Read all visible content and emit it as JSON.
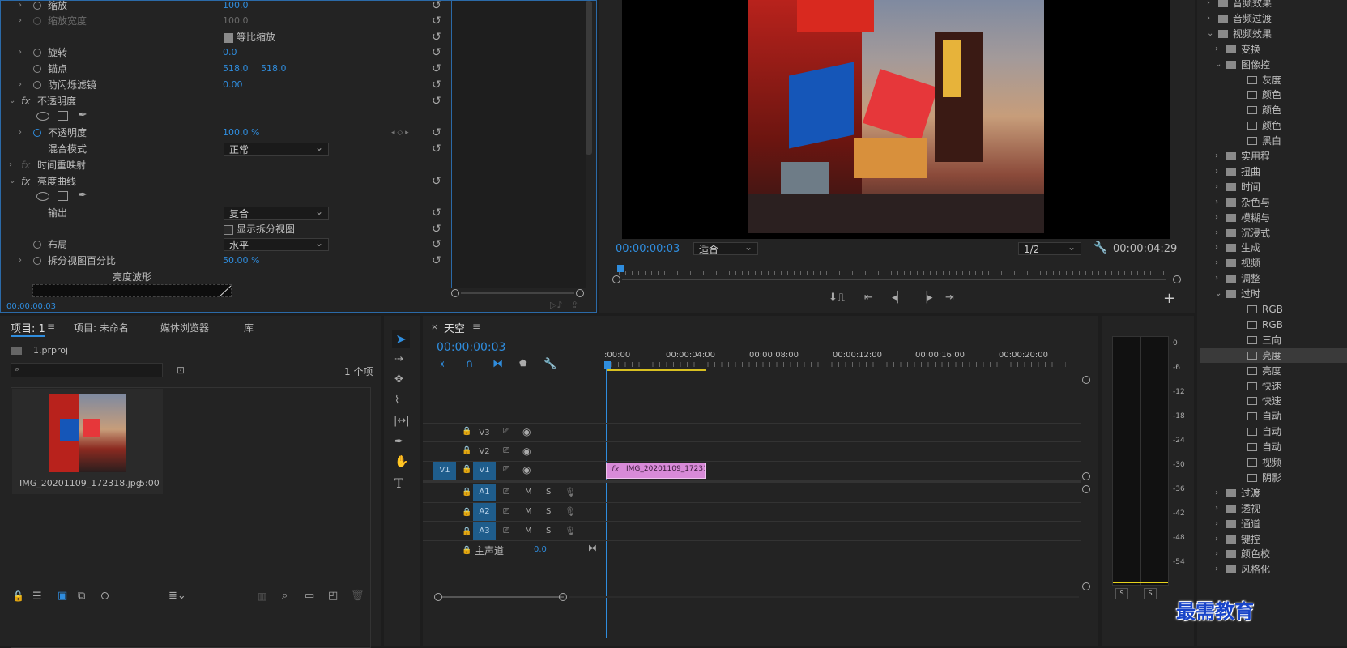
{
  "effect_controls": {
    "rows": [
      {
        "label": "缩放",
        "value": "100.0"
      },
      {
        "label": "缩放宽度",
        "value": "100.0"
      },
      {
        "checkbox_label": "等比缩放"
      },
      {
        "label": "旋转",
        "value": "0.0"
      },
      {
        "label": "锚点",
        "value1": "518.0",
        "value2": "518.0"
      },
      {
        "label": "防闪烁滤镜",
        "value": "0.00"
      },
      {
        "label": "不透明度",
        "fx": "fx"
      },
      {
        "label": "不透明度",
        "value": "100.0 %"
      },
      {
        "label": "混合模式",
        "select": "正常"
      },
      {
        "label": "时间重映射",
        "fx": "fx"
      },
      {
        "label": "亮度曲线",
        "fx": "fx"
      },
      {
        "label": "输出",
        "select": "复合"
      },
      {
        "checkbox_label": "显示拆分视图"
      },
      {
        "label": "布局",
        "select": "水平"
      },
      {
        "label": "拆分视图百分比",
        "value": "50.00 %"
      },
      {
        "label": "亮度波形"
      }
    ],
    "timecode": "00:00:00:03"
  },
  "program_monitor": {
    "current_time": "00:00:00:03",
    "zoom": "适合",
    "resolution": "1/2",
    "duration": "00:00:04:29"
  },
  "project": {
    "tabs": [
      "项目: 1",
      "项目: 未命名",
      "媒体浏览器",
      "库"
    ],
    "file": "1.prproj",
    "item_count": "1 个项",
    "clip_name": "IMG_20201109_172318.jpg",
    "clip_duration": "5:00"
  },
  "timeline": {
    "title": "天空",
    "timecode": "00:00:00:03",
    "ruler": [
      ":00:00",
      "00:00:04:00",
      "00:00:08:00",
      "00:00:12:00",
      "00:00:16:00",
      "00:00:20:00"
    ],
    "video_tracks": [
      "V3",
      "V2",
      "V1"
    ],
    "source_patch": "V1",
    "audio_tracks": [
      "A1",
      "A2",
      "A3"
    ],
    "master_label": "主声道",
    "master_value": "0.0",
    "clip_label": "IMG_20201109_172318.",
    "m": "M",
    "s": "S"
  },
  "meter": {
    "scale": [
      "0",
      "-6",
      "-12",
      "-18",
      "-24",
      "-30",
      "-36",
      "-42",
      "-48",
      "-54"
    ],
    "solo": "S"
  },
  "effects_panel": {
    "items": [
      {
        "t": "folder",
        "label": "音频效果",
        "d": 0
      },
      {
        "t": "folder",
        "label": "音频过渡",
        "d": 0
      },
      {
        "t": "folder",
        "label": "视频效果",
        "d": 0,
        "open": true
      },
      {
        "t": "folder",
        "label": "变换",
        "d": 1
      },
      {
        "t": "folder",
        "label": "图像控",
        "d": 1,
        "open": true
      },
      {
        "t": "fx",
        "label": "灰度",
        "d": 2
      },
      {
        "t": "fx",
        "label": "颜色",
        "d": 2
      },
      {
        "t": "fx",
        "label": "颜色",
        "d": 2
      },
      {
        "t": "fx",
        "label": "颜色",
        "d": 2
      },
      {
        "t": "fx",
        "label": "黑白",
        "d": 2
      },
      {
        "t": "folder",
        "label": "实用程",
        "d": 1
      },
      {
        "t": "folder",
        "label": "扭曲",
        "d": 1
      },
      {
        "t": "folder",
        "label": "时间",
        "d": 1
      },
      {
        "t": "folder",
        "label": "杂色与",
        "d": 1
      },
      {
        "t": "folder",
        "label": "模糊与",
        "d": 1
      },
      {
        "t": "folder",
        "label": "沉浸式",
        "d": 1
      },
      {
        "t": "folder",
        "label": "生成",
        "d": 1
      },
      {
        "t": "folder",
        "label": "视频",
        "d": 1
      },
      {
        "t": "folder",
        "label": "调整",
        "d": 1
      },
      {
        "t": "folder",
        "label": "过时",
        "d": 1,
        "open": true
      },
      {
        "t": "fx",
        "label": "RGB",
        "d": 2
      },
      {
        "t": "fx",
        "label": "RGB",
        "d": 2
      },
      {
        "t": "fx",
        "label": "三向",
        "d": 2
      },
      {
        "t": "fx",
        "label": "亮度",
        "d": 2,
        "selected": true
      },
      {
        "t": "fx",
        "label": "亮度",
        "d": 2
      },
      {
        "t": "fx",
        "label": "快速",
        "d": 2
      },
      {
        "t": "fx",
        "label": "快速",
        "d": 2
      },
      {
        "t": "fx",
        "label": "自动",
        "d": 2
      },
      {
        "t": "fx",
        "label": "自动",
        "d": 2
      },
      {
        "t": "fx",
        "label": "自动",
        "d": 2
      },
      {
        "t": "fx",
        "label": "视频",
        "d": 2
      },
      {
        "t": "fx",
        "label": "阴影",
        "d": 2
      },
      {
        "t": "folder",
        "label": "过渡",
        "d": 1
      },
      {
        "t": "folder",
        "label": "透视",
        "d": 1
      },
      {
        "t": "folder",
        "label": "通道",
        "d": 1
      },
      {
        "t": "folder",
        "label": "键控",
        "d": 1
      },
      {
        "t": "folder",
        "label": "颜色校",
        "d": 1
      },
      {
        "t": "folder",
        "label": "风格化",
        "d": 1
      }
    ]
  },
  "watermark": "最需教育"
}
